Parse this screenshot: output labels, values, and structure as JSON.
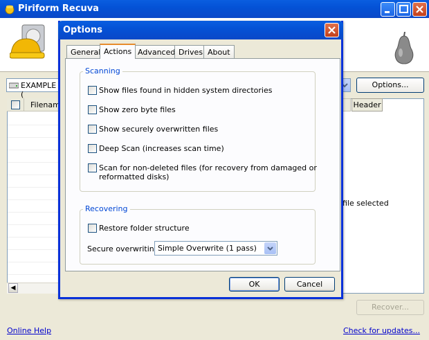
{
  "main_window": {
    "title": "Piriform Recuva",
    "drive_label": "EXAMPLE (",
    "options_button": "Options...",
    "columns": {
      "filename": "Filename",
      "header_tab": "Header"
    },
    "status_text": "file selected",
    "recover_button": "Recover...",
    "online_help": "Online Help",
    "check_updates": "Check for updates..."
  },
  "dialog": {
    "title": "Options",
    "tabs": [
      {
        "label": "General",
        "active": false
      },
      {
        "label": "Actions",
        "active": true
      },
      {
        "label": "Advanced",
        "active": false
      },
      {
        "label": "Drives",
        "active": false
      },
      {
        "label": "About",
        "active": false
      }
    ],
    "scanning": {
      "title": "Scanning",
      "options": [
        {
          "label": "Show files found in hidden system directories",
          "checked": false
        },
        {
          "label": "Show zero byte files",
          "checked": false
        },
        {
          "label": "Show securely overwritten files",
          "checked": false
        },
        {
          "label": "Deep Scan (increases scan time)",
          "checked": false
        },
        {
          "label": "Scan for non-deleted files (for recovery from damaged or",
          "label2": "reformatted disks)",
          "checked": false
        }
      ]
    },
    "recovering": {
      "title": "Recovering",
      "restore_folder": {
        "label": "Restore folder structure",
        "checked": false
      },
      "secure_overwriting_label": "Secure overwriting",
      "secure_overwriting_value": "Simple Overwrite (1 pass)"
    },
    "ok_button": "OK",
    "cancel_button": "Cancel"
  },
  "colors": {
    "xp_blue": "#0a5ee0",
    "group_title": "#0046d5",
    "link": "#0000cc"
  }
}
